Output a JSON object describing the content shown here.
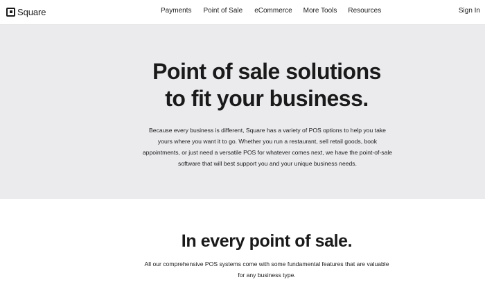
{
  "header": {
    "logo_text": "Square",
    "nav": [
      "Payments",
      "Point of Sale",
      "eCommerce",
      "More Tools",
      "Resources"
    ],
    "signin_label": "Sign In"
  },
  "hero": {
    "title_line1": "Point of sale solutions",
    "title_line2": "to fit your business.",
    "body": "Because every business is different, Square has a variety of POS options to help you take yours where you want it to go. Whether you run a restaurant, sell retail goods, book appointments, or just need a versatile POS for whatever comes next, we have the point-of-sale software that will best support you and your unique business needs."
  },
  "section": {
    "title": "In every point of sale.",
    "body": "All our comprehensive POS systems come with some fundamental features that are valuable for any business type."
  },
  "colors": {
    "hero_background": "#ebebee",
    "text": "#1a1a1a",
    "page_background": "#ffffff"
  },
  "icons": {
    "logo": "square-logo-icon"
  }
}
